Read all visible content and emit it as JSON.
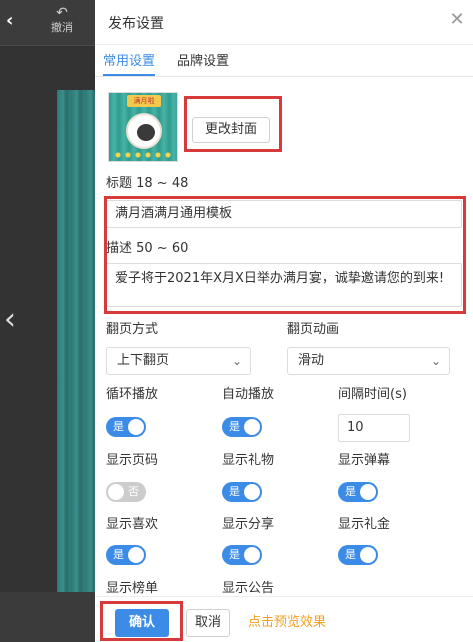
{
  "background": {
    "undo_label": "撤消",
    "back_icon": "chevron-left-icon",
    "nav_prev_icon": "chevron-left-icon"
  },
  "dialog": {
    "title": "发布设置",
    "close_icon": "close-icon"
  },
  "tabs": [
    {
      "label": "常用设置",
      "active": true
    },
    {
      "label": "品牌设置",
      "active": false
    }
  ],
  "cover": {
    "ribbon_text": "满月啦",
    "change_button": "更改封面"
  },
  "fields": {
    "title_label": "标题 18 ~ 48",
    "title_value": "满月酒满月通用模板",
    "desc_label": "描述 50 ~ 60",
    "desc_value": "爱子将于2021年X月X日举办满月宴，诚挚邀请您的到来!"
  },
  "flip": {
    "mode_label": "翻页方式",
    "mode_value": "上下翻页",
    "anim_label": "翻页动画",
    "anim_value": "滑动"
  },
  "toggles": {
    "loop": {
      "label": "循环播放",
      "state": "是",
      "on": true
    },
    "autoplay": {
      "label": "自动播放",
      "state": "是",
      "on": true
    },
    "show_page": {
      "label": "显示页码",
      "state": "否",
      "on": false
    },
    "show_gift": {
      "label": "显示礼物",
      "state": "是",
      "on": true
    },
    "show_danmu": {
      "label": "显示弹幕",
      "state": "是",
      "on": true
    },
    "show_like": {
      "label": "显示喜欢",
      "state": "是",
      "on": true
    },
    "show_share": {
      "label": "显示分享",
      "state": "是",
      "on": true
    },
    "show_gift_money": {
      "label": "显示礼金",
      "state": "是",
      "on": true
    }
  },
  "interval": {
    "label": "间隔时间(s)",
    "value": "10"
  },
  "partial_labels": {
    "show_rank": "显示榜单",
    "show_notice": "显示公告"
  },
  "footer": {
    "confirm": "确认",
    "cancel": "取消",
    "preview": "点击预览效果"
  },
  "colors": {
    "accent": "#3c8ce7",
    "highlight": "#d63a3a",
    "preview_link": "#f0a020",
    "toggle_off": "#cccccc"
  }
}
